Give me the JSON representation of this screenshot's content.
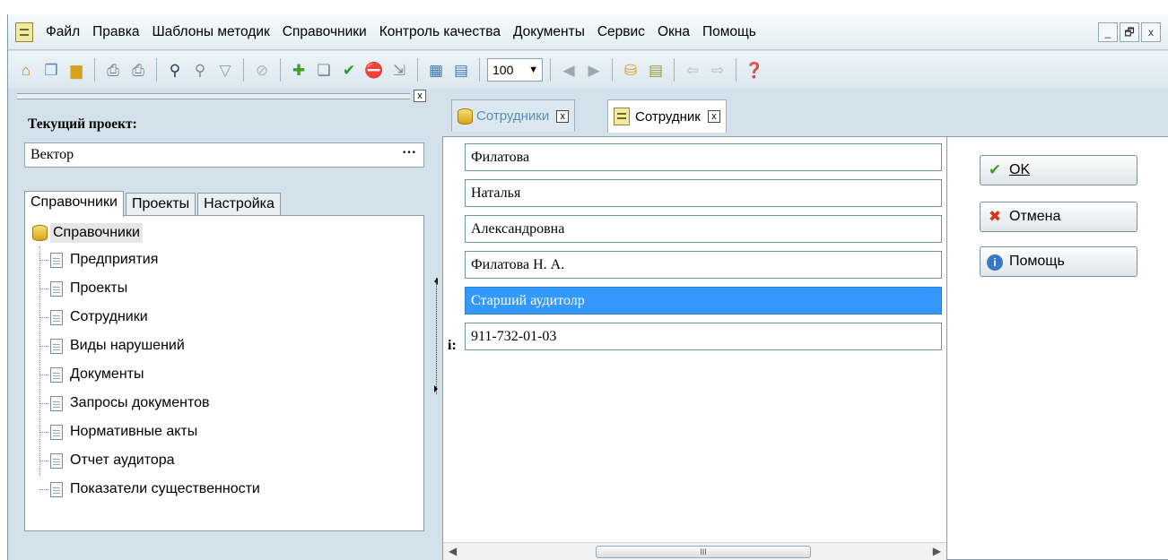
{
  "menu": [
    "Файл",
    "Правка",
    "Шаблоны методик",
    "Справочники",
    "Контроль качества",
    "Документы",
    "Сервис",
    "Окна",
    "Помощь"
  ],
  "window_controls": {
    "minimize": "_",
    "restore": "🗗",
    "close": "x"
  },
  "toolbar": {
    "zoom_value": "100",
    "icons": [
      "home-icon",
      "pages-icon",
      "folder-icon",
      "print-preview-icon",
      "print-icon",
      "search-icon",
      "search-next-icon",
      "filter-icon",
      "stop-icon",
      "add-icon",
      "copy-icon",
      "apply-icon",
      "delete-icon",
      "export-icon",
      "calculator-icon",
      "calendar-icon",
      "zoom-select",
      "back-circle-icon",
      "forward-circle-icon",
      "database-icon",
      "notes-icon",
      "arrow-left-icon",
      "arrow-right-icon",
      "help-icon"
    ]
  },
  "left_panel": {
    "close_glyph": "x",
    "current_project_label": "Текущий проект:",
    "current_project_value": "Вектор",
    "browse_glyph": "···",
    "tabs": [
      "Справочники",
      "Проекты",
      "Настройка"
    ],
    "tree_root": "Справочники",
    "tree_items": [
      "Предприятия",
      "Проекты",
      "Сотрудники",
      "Виды нарушений",
      "Документы",
      "Запросы документов",
      "Нормативные акты",
      "Отчет аудитора",
      "Показатели существенности"
    ]
  },
  "doc_tabs": [
    {
      "label": "Сотрудники",
      "close": "x"
    },
    {
      "label": "Сотрудник",
      "close": "x"
    }
  ],
  "form": {
    "fields": [
      "Филатова",
      "Наталья",
      "Александровна",
      "Филатова Н. А.",
      "Старший аудитолр",
      "911-732-01-03"
    ],
    "cut_label": "і:",
    "scrollbar_grip": "III"
  },
  "buttons": {
    "ok": "OK",
    "cancel": "Отмена",
    "help": "Помощь"
  }
}
